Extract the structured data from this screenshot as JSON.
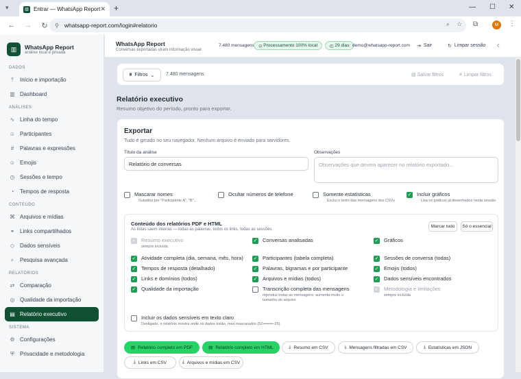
{
  "browser": {
    "tab_title": "Entrar — WhatsApp Report",
    "url": "whatsapp-report.com/login#relatorio",
    "avatar": "M"
  },
  "brand": {
    "name": "WhatsApp Report",
    "sub": "análise local e privada"
  },
  "sidebar": {
    "sections": [
      {
        "title": "DADOS",
        "items": [
          {
            "label": "Início e importação",
            "icon": "⤒"
          },
          {
            "label": "Dashboard",
            "icon": "▥"
          }
        ]
      },
      {
        "title": "ANÁLISES",
        "items": [
          {
            "label": "Linha do tempo",
            "icon": "∿"
          },
          {
            "label": "Participantes",
            "icon": "☺"
          },
          {
            "label": "Palavras e expressões",
            "icon": "#"
          },
          {
            "label": "Emojis",
            "icon": "☺"
          },
          {
            "label": "Sessões e tempo",
            "icon": "◷"
          },
          {
            "label": "Tempos de resposta",
            "icon": "◔"
          }
        ]
      },
      {
        "title": "CONTEÚDO",
        "items": [
          {
            "label": "Arquivos e mídias",
            "icon": "⌘"
          },
          {
            "label": "Links compartilhados",
            "icon": "⚭"
          },
          {
            "label": "Dados sensíveis",
            "icon": "◇"
          },
          {
            "label": "Pesquisa avançada",
            "icon": "⌕"
          }
        ]
      },
      {
        "title": "RELATÓRIOS",
        "items": [
          {
            "label": "Comparação",
            "icon": "⇄"
          },
          {
            "label": "Qualidade da importação",
            "icon": "◎"
          },
          {
            "label": "Relatório executivo",
            "icon": "▤",
            "active": true
          }
        ]
      },
      {
        "title": "SISTEMA",
        "items": [
          {
            "label": "Configurações",
            "icon": "⚙"
          },
          {
            "label": "Privacidade e metodologia",
            "icon": "⛨"
          }
        ]
      }
    ]
  },
  "topbar": {
    "title": "WhatsApp Report",
    "sub": "Conversas exportadas viram informação visual",
    "count": "7.480 mensagens",
    "processing": "Processamento 100% local",
    "days": "29 dias",
    "email": "demo@whatsapp-report.com",
    "logout": "Sair",
    "clear": "Limpar sessão"
  },
  "filters": {
    "label": "Filtros",
    "count": "7.480 mensagens",
    "save": "Salvar filtros",
    "clear": "Limpar filtros"
  },
  "page": {
    "title": "Relatório executivo",
    "sub": "Resumo objetivo do período, pronto para exportar."
  },
  "export": {
    "title": "Exportar",
    "sub": "Tudo é gerado no seu navegador. Nenhum arquivo é enviado para servidores.",
    "analysis_label": "Título da análise",
    "analysis_value": "Relatório de conversas",
    "notes_label": "Observações",
    "notes_placeholder": "Observações que devem aparecer no relatório exportado...",
    "options": [
      {
        "label": "Mascarar nomes",
        "hint": "Substitui por \"Participante A\", \"B\"...",
        "checked": false
      },
      {
        "label": "Ocultar números de telefone",
        "hint": "",
        "checked": false
      },
      {
        "label": "Somente estatísticas",
        "hint": "Exclui o texto das mensagens dos CSVs",
        "checked": false
      },
      {
        "label": "Incluir gráficos",
        "hint": "Usa os gráficos já desenhados nesta sessão",
        "checked": true
      }
    ],
    "content": {
      "title": "Conteúdo dos relatórios PDF e HTML",
      "sub": "As listas saem inteiras — todas as palavras, todos os links, todas as sessões.",
      "mark_all": "Marcar tudo",
      "essential": "Só o essencial",
      "items": [
        {
          "label": "Resumo executivo",
          "hint": "sempre incluída",
          "state": "disabled"
        },
        {
          "label": "Conversas analisadas",
          "hint": "",
          "state": "on"
        },
        {
          "label": "Gráficos",
          "hint": "",
          "state": "on"
        },
        {
          "label": "Atividade completa (dia, semana, mês, hora)",
          "hint": "",
          "state": "on"
        },
        {
          "label": "Participantes (tabela completa)",
          "hint": "",
          "state": "on"
        },
        {
          "label": "Sessões de conversa (todas)",
          "hint": "",
          "state": "on"
        },
        {
          "label": "Tempos de resposta (detalhado)",
          "hint": "",
          "state": "on"
        },
        {
          "label": "Palavras, bigramas e por participante",
          "hint": "",
          "state": "on"
        },
        {
          "label": "Emojis (todos)",
          "hint": "",
          "state": "on"
        },
        {
          "label": "Links e domínios (todos)",
          "hint": "",
          "state": "on"
        },
        {
          "label": "Arquivos e mídias (todos)",
          "hint": "",
          "state": "on"
        },
        {
          "label": "Dados sensíveis encontrados",
          "hint": "",
          "state": "on"
        },
        {
          "label": "Qualidade da importação",
          "hint": "",
          "state": "on"
        },
        {
          "label": "Transcrição completa das mensagens",
          "hint": "reproduz todas as mensagens; aumenta muito o tamanho do arquivo",
          "state": "off"
        },
        {
          "label": "Metodologia e limitações",
          "hint": "sempre incluída",
          "state": "disabled"
        }
      ],
      "sensitive": {
        "label": "Incluir os dados sensíveis em texto claro",
        "hint": "Desligado, o relatório mostra onde os dados estão, mas mascarados (52••••••••-25)."
      }
    },
    "buttons": [
      {
        "label": "Relatório completo em PDF",
        "primary": true
      },
      {
        "label": "Relatório completo em HTML",
        "primary": true
      },
      {
        "label": "Resumo em CSV",
        "primary": false
      },
      {
        "label": "Mensagens filtradas em CSV",
        "primary": false
      },
      {
        "label": "Estatísticas em JSON",
        "primary": false
      },
      {
        "label": "Links em CSV",
        "primary": false
      },
      {
        "label": "Arquivos e mídias em CSV",
        "primary": false
      }
    ]
  }
}
